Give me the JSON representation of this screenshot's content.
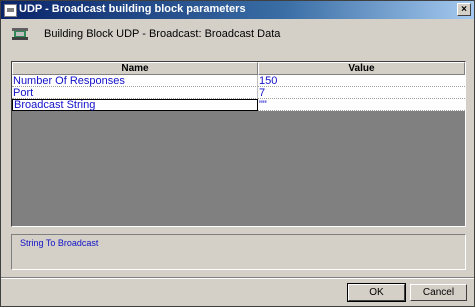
{
  "window": {
    "title": "UDP - Broadcast building block parameters",
    "close_glyph": "×"
  },
  "header": {
    "icon": "building-block-icon",
    "label": "Building Block UDP - Broadcast: Broadcast Data"
  },
  "grid": {
    "columns": [
      "Name",
      "Value"
    ],
    "rows": [
      {
        "name": "Number Of Responses",
        "value": "150"
      },
      {
        "name": "Port",
        "value": "7"
      },
      {
        "name": "Broadcast String",
        "value": "\"\""
      }
    ],
    "selected_row": "Broadcast String"
  },
  "description": "String To Broadcast",
  "buttons": {
    "ok": "OK",
    "cancel": "Cancel"
  },
  "colors": {
    "title_gradient_start": "#0a246a",
    "title_gradient_end": "#a6caf0",
    "value_text": "#1010c8",
    "dialog_face": "#d4d0c8"
  }
}
